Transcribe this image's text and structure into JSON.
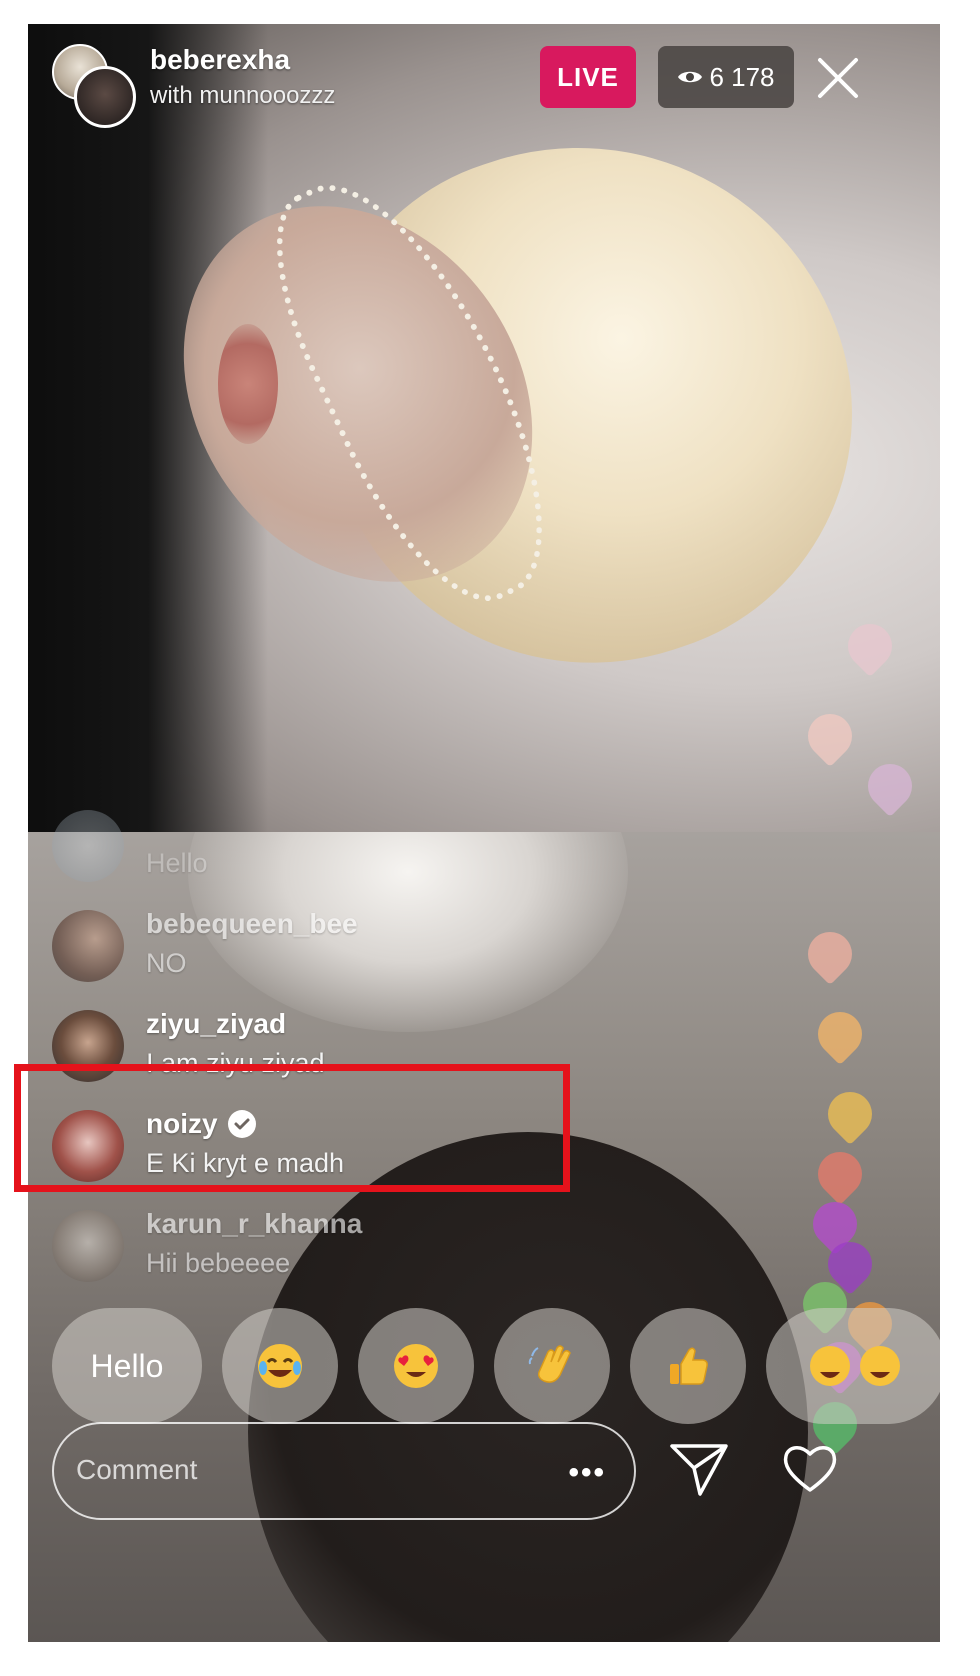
{
  "header": {
    "host_name": "beberexha",
    "co_host_line": "with munnooozzz",
    "live_label": "LIVE",
    "viewer_count": "6 178",
    "eye_icon": "eye-icon",
    "close_icon": "close-icon"
  },
  "comments": [
    {
      "username": "",
      "text": "Hello",
      "verified": false
    },
    {
      "username": "bebequeen_bee",
      "text": "NO",
      "verified": false
    },
    {
      "username": "ziyu_ziyad",
      "text": "I am ziyu ziyad",
      "verified": false
    },
    {
      "username": "noizy",
      "text": "E Ki kryt e madh",
      "verified": true
    },
    {
      "username": "karun_r_khanna",
      "text": "Hii bebeeee",
      "verified": false
    }
  ],
  "quick_replies": [
    {
      "label": "Hello",
      "icon": ""
    },
    {
      "label": "",
      "icon": "laughing-tears-emoji-icon"
    },
    {
      "label": "",
      "icon": "heart-eyes-emoji-icon"
    },
    {
      "label": "",
      "icon": "waving-hand-emoji-icon"
    },
    {
      "label": "",
      "icon": "thumbs-up-emoji-icon"
    },
    {
      "label": "",
      "icon": "double-laughing-emoji-icon"
    }
  ],
  "comment_bar": {
    "placeholder": "Comment",
    "more_label": "•••",
    "send_icon": "send-icon",
    "like_icon": "heart-icon"
  },
  "colors": {
    "live_badge": "#d8195e",
    "highlight_box": "#e5121b",
    "viewer_badge": "#464240"
  }
}
